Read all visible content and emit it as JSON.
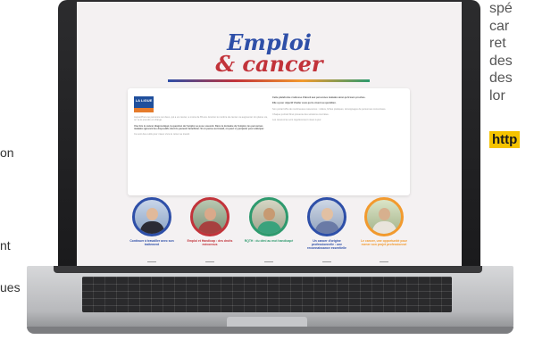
{
  "background_text": {
    "left_fragments": [
      "on",
      "nt",
      "ues"
    ],
    "right_lines": [
      "spé",
      "car",
      "ret",
      "des",
      "des",
      "lor"
    ],
    "right_link": "http"
  },
  "screen": {
    "title_line1": "Emploi",
    "title_line2": "& cancer",
    "logo": {
      "text": "LA LIGUE"
    },
    "card_left_paragraphs": [
      "Aujourd'hui une personne sur deux, qui a un cancer, a moins de 65 ans. Environ le nombre de cancer va augmenter. En pleine vie, on va le prendre en charge.",
      "Une fois le cancer diagnostiqué, la question de l'emploi se pose souvent. Dans le domaine de l'emploi, les personnes malades ignorent les dispositifs dont ils peuvent bénéficier. Si on pense au travail, on peut s'y préparer pour anticiper.",
      "Ce sont des outils pour mieux vivre le retour au travail."
    ],
    "card_right_paragraphs": [
      "Cette plateforme s'adresse d'abord aux personnes malades ainsi qu'à leurs proches.",
      "Elle a pour objectif d'aider ceux qui le vivent au quotidien.",
      "Son portail offre de nombreuses ressources : vidéos, fiches pratiques, témoignages de personnes concernées.",
      "Chaque portrait filmé présente des solutions concrètes.",
      "Les ressources sont régulièrement mises à jour."
    ],
    "portraits": [
      {
        "caption": "Continuer à travailler avec son traitement",
        "color": "#2e4fa8"
      },
      {
        "caption": "Emploi et Handicap : des droits méconnus",
        "color": "#c2333a"
      },
      {
        "caption": "RQTH : du déni au mot handicapé",
        "color": "#2e9a6e"
      },
      {
        "caption": "Un cancer d'origine professionnelle : une reconnaissance essentielle",
        "color": "#2e4fa8"
      },
      {
        "caption": "Le cancer, une opportunité pour mener son projet professionnel",
        "color": "#f29a2e"
      }
    ]
  }
}
